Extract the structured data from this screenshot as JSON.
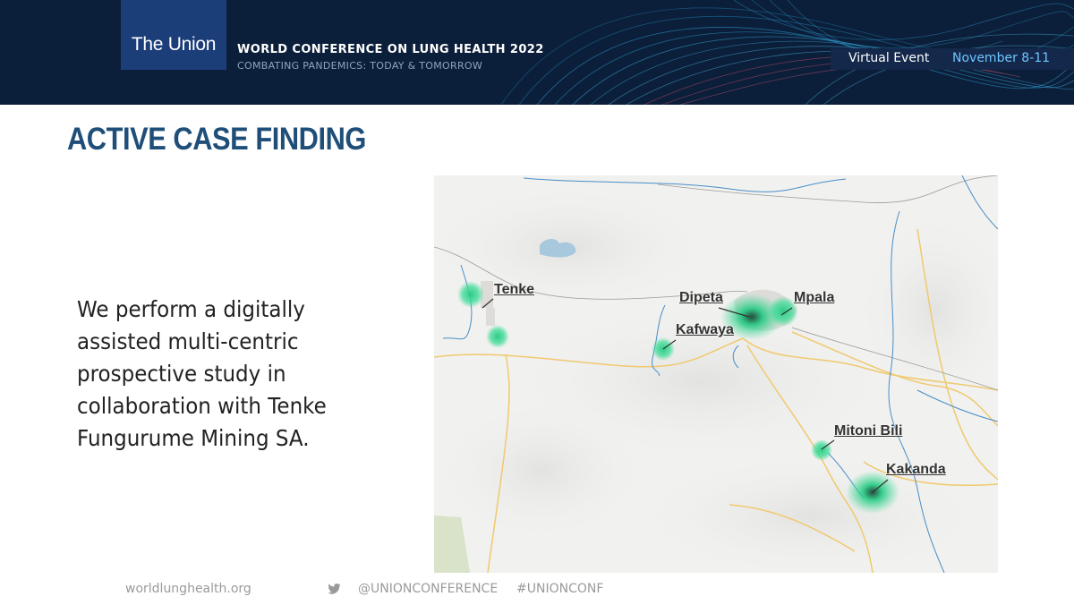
{
  "header": {
    "logo": "The Union",
    "conference_title": "WORLD CONFERENCE ON LUNG HEALTH 2022",
    "conference_subtitle": "COMBATING PANDEMICS: TODAY & TOMORROW",
    "virtual_label": "Virtual Event",
    "virtual_dates": "November 8-11"
  },
  "slide": {
    "title": "ACTIVE CASE FINDING",
    "body": "We perform a digitally assisted multi-centric prospective study in collaboration with Tenke Fungurume Mining SA."
  },
  "map": {
    "labels": {
      "tenke": "Tenke",
      "dipeta": "Dipeta",
      "mpala": "Mpala",
      "kafwaya": "Kafwaya",
      "mitoni_bili": "Mitoni Bili",
      "kakanda": "Kakanda"
    },
    "hotspot_color": "#3ddc97"
  },
  "footer": {
    "website": "worldlunghealth.org",
    "twitter_icon": "twitter-icon",
    "handle": "@UNIONCONFERENCE",
    "hashtag": "#UNIONCONF"
  }
}
